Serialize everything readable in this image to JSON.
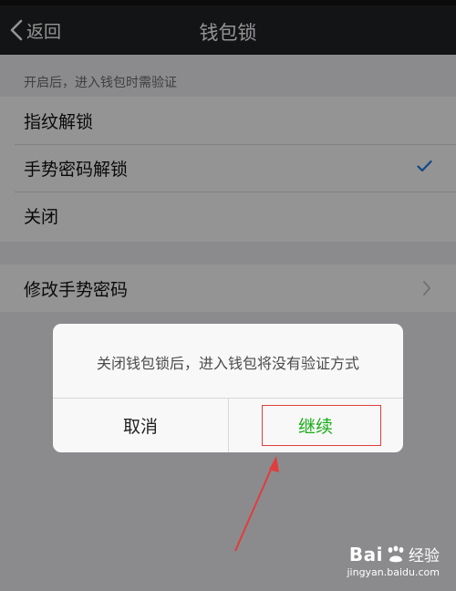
{
  "nav": {
    "back_label": "返回",
    "title": "钱包锁"
  },
  "settings": {
    "hint": "开启后，进入钱包时需验证",
    "options": [
      {
        "label": "指纹解锁",
        "checked": false
      },
      {
        "label": "手势密码解锁",
        "checked": true
      },
      {
        "label": "关闭",
        "checked": false
      }
    ],
    "change_gesture_label": "修改手势密码"
  },
  "dialog": {
    "message": "关闭钱包锁后，进入钱包将没有验证方式",
    "cancel_label": "取消",
    "continue_label": "继续"
  },
  "watermark": {
    "brand": "Bai",
    "brand_suffix": "经验",
    "url": "jingyan.baidu.com"
  },
  "colors": {
    "nav_background": "#222326",
    "accent_green": "#1aad19",
    "check_blue": "#1e7ee6",
    "annotation_red": "#e03d3d"
  },
  "icons": {
    "back": "chevron-left-icon",
    "selected": "checkmark-icon",
    "disclosure": "chevron-right-icon",
    "annotation": "red-arrow"
  }
}
